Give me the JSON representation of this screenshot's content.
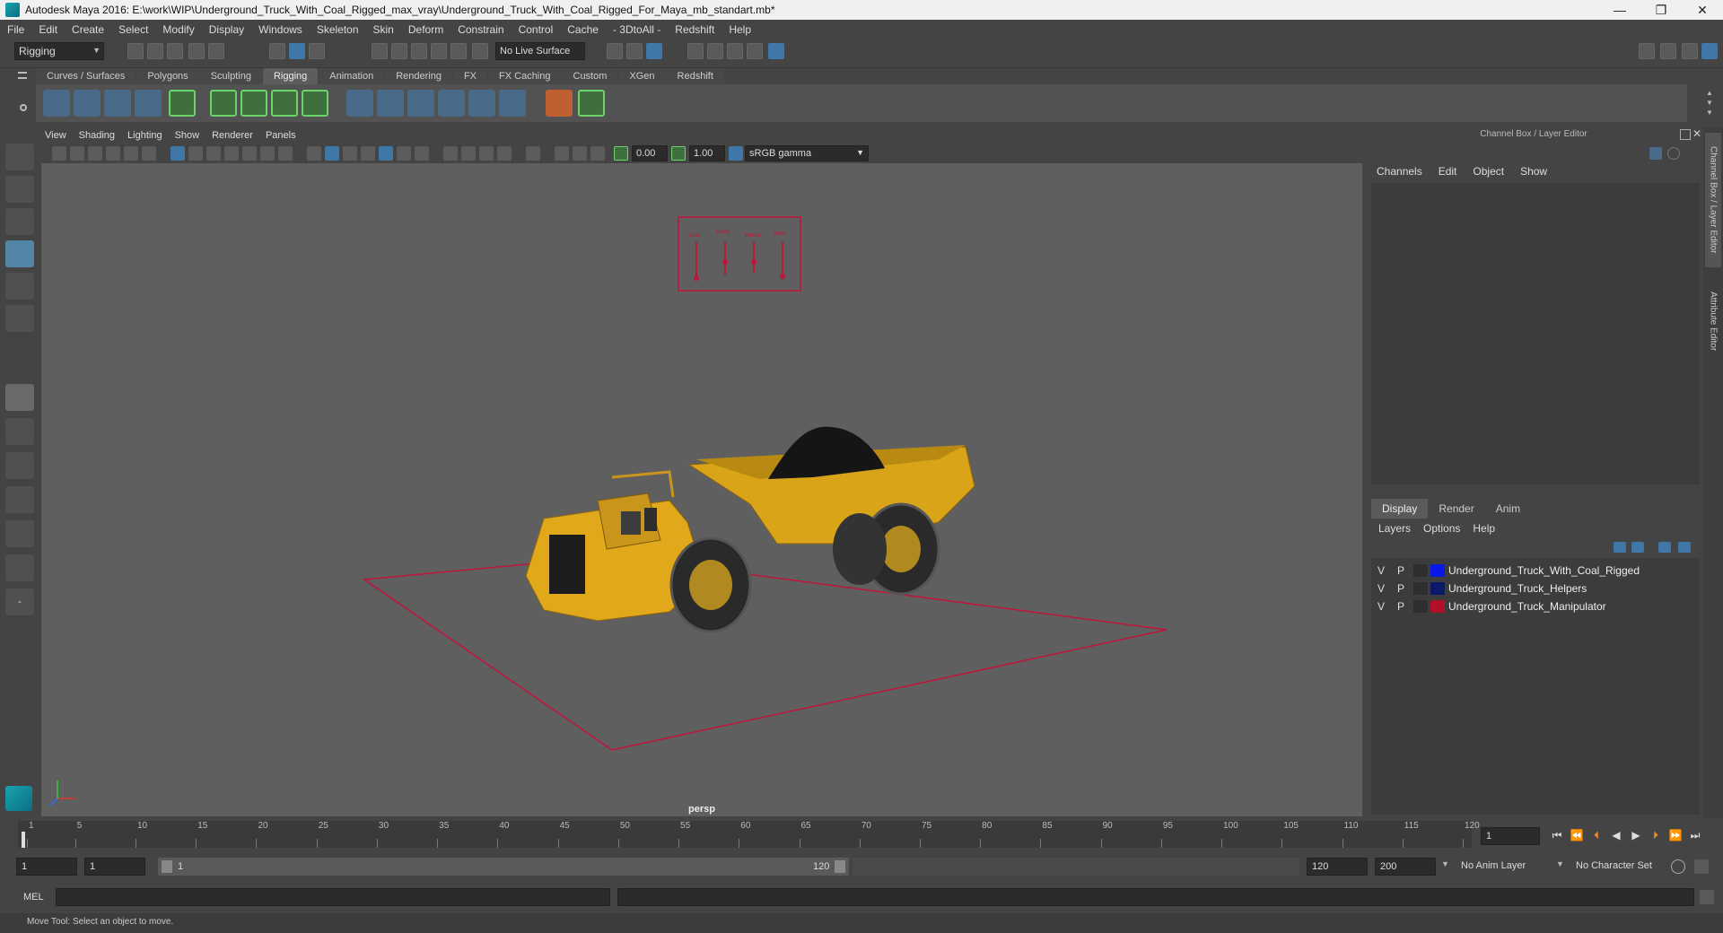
{
  "window": {
    "title": "Autodesk Maya 2016: E:\\work\\WIP\\Underground_Truck_With_Coal_Rigged_max_vray\\Underground_Truck_With_Coal_Rigged_For_Maya_mb_standart.mb*",
    "minimize": "—",
    "maximize": "❐",
    "close": "✕"
  },
  "menubar": [
    "File",
    "Edit",
    "Create",
    "Select",
    "Modify",
    "Display",
    "Windows",
    "Skeleton",
    "Skin",
    "Deform",
    "Constrain",
    "Control",
    "Cache",
    "- 3DtoAll -",
    "Redshift",
    "Help"
  ],
  "statusline": {
    "mode": "Rigging",
    "live_surface": "No Live Surface"
  },
  "shelf": {
    "tabs": [
      "Curves / Surfaces",
      "Polygons",
      "Sculpting",
      "Rigging",
      "Animation",
      "Rendering",
      "FX",
      "FX Caching",
      "Custom",
      "XGen",
      "Redshift"
    ],
    "active_tab": "Rigging"
  },
  "viewport": {
    "menus": [
      "View",
      "Shading",
      "Lighting",
      "Show",
      "Renderer",
      "Panels"
    ],
    "exposure": "0.00",
    "gamma": "1.00",
    "color_space": "sRGB gamma",
    "camera_label": "persp"
  },
  "channelbox": {
    "title": "Channel Box / Layer Editor",
    "menus": [
      "Channels",
      "Edit",
      "Object",
      "Show"
    ]
  },
  "layer_editor": {
    "tabs": [
      "Display",
      "Render",
      "Anim"
    ],
    "active_tab": "Display",
    "menus": [
      "Layers",
      "Options",
      "Help"
    ],
    "layers": [
      {
        "v": "V",
        "p": "P",
        "name": "Underground_Truck_With_Coal_Rigged",
        "color": "#0a18e6"
      },
      {
        "v": "V",
        "p": "P",
        "name": "Underground_Truck_Helpers",
        "color": "#0a1a6a"
      },
      {
        "v": "V",
        "p": "P",
        "name": "Underground_Truck_Manipulator",
        "color": "#b0102a"
      }
    ]
  },
  "side_tabs": [
    "Channel Box / Layer Editor",
    "Attribute Editor"
  ],
  "timeline": {
    "ticks": [
      "1",
      "5",
      "10",
      "15",
      "20",
      "25",
      "30",
      "35",
      "40",
      "45",
      "50",
      "55",
      "60",
      "65",
      "70",
      "75",
      "80",
      "85",
      "90",
      "95",
      "100",
      "105",
      "110",
      "115",
      "120"
    ],
    "current_frame": "1"
  },
  "range": {
    "start": "1",
    "playback_start": "1",
    "slider_start": "1",
    "slider_end": "120",
    "playback_end": "120",
    "end": "200",
    "anim_layer": "No Anim Layer",
    "character_set": "No Character Set"
  },
  "command": {
    "label": "MEL"
  },
  "help_line": "Move Tool: Select an object to move.",
  "rig_labels": [
    "Coal",
    "Dump",
    "Wheel",
    "Steer"
  ]
}
